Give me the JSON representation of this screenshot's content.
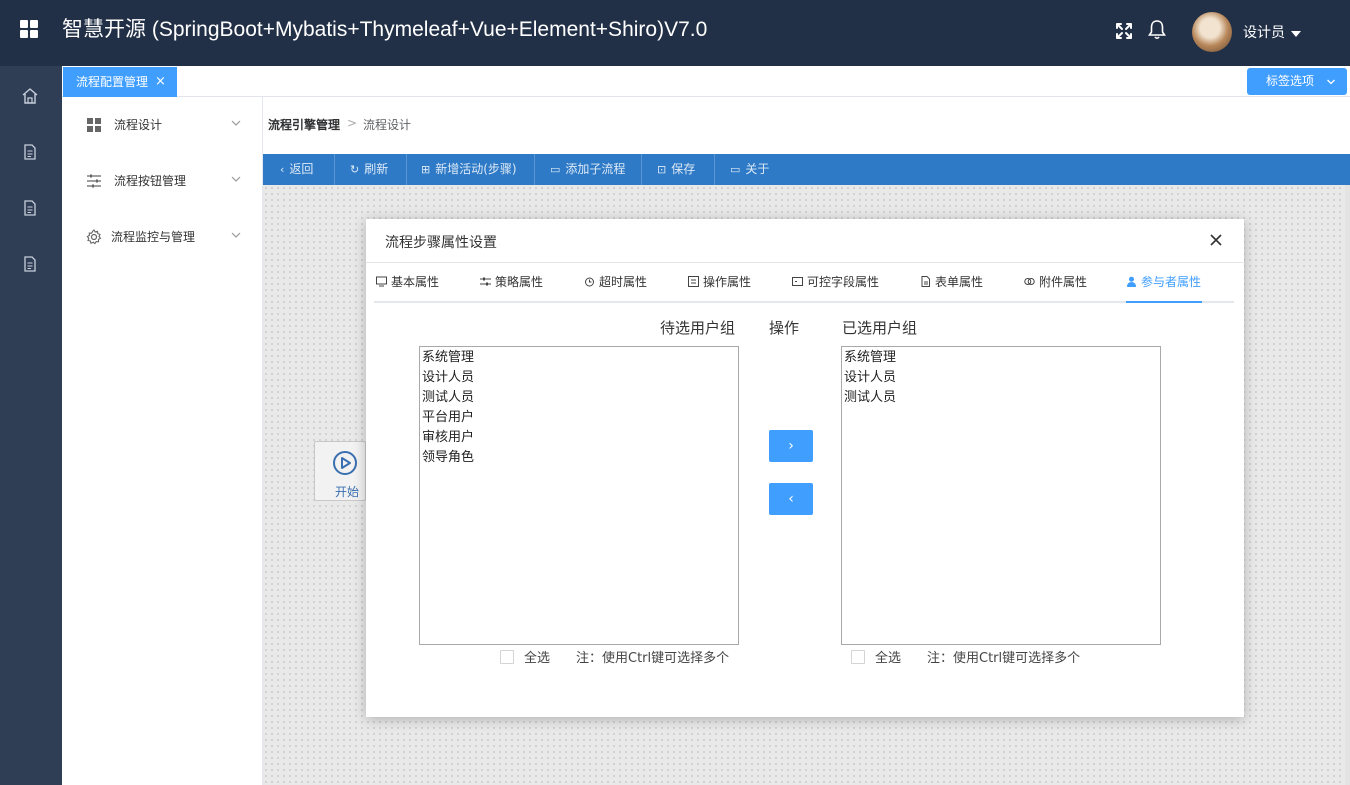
{
  "header": {
    "title": "智慧开源 (SpringBoot+Mybatis+Thymeleaf+Vue+Element+Shiro)V7.0",
    "user_name": "设计员"
  },
  "tabs": {
    "active_label": "流程配置管理",
    "close_glyph": "×",
    "tag_options_label": "标签选项"
  },
  "sidebar": {
    "items": [
      {
        "label": "流程设计",
        "icon": "grid-icon"
      },
      {
        "label": "流程按钮管理",
        "icon": "sliders-icon"
      },
      {
        "label": "流程监控与管理",
        "icon": "gear-icon"
      }
    ]
  },
  "breadcrumb": {
    "root": "流程引擎管理",
    "separator": ">",
    "current": "流程设计"
  },
  "toolbar": {
    "buttons": [
      {
        "label": "返回",
        "icon": "‹"
      },
      {
        "label": "刷新",
        "icon": "↻"
      },
      {
        "label": "新增活动(步骤)",
        "icon": "⊞"
      },
      {
        "label": "添加子流程",
        "icon": "▭"
      },
      {
        "label": "保存",
        "icon": "⊡"
      },
      {
        "label": "关于",
        "icon": "▭"
      }
    ]
  },
  "canvas": {
    "start_node_label": "开始"
  },
  "modal": {
    "title": "流程步骤属性设置",
    "tabs": [
      {
        "label": "基本属性"
      },
      {
        "label": "策略属性"
      },
      {
        "label": "超时属性"
      },
      {
        "label": "操作属性"
      },
      {
        "label": "可控字段属性"
      },
      {
        "label": "表单属性"
      },
      {
        "label": "附件属性"
      },
      {
        "label": "参与者属性",
        "active": true
      }
    ],
    "available_header": "待选用户组",
    "ops_header": "操作",
    "selected_header": "已选用户组",
    "available_groups": [
      "系统管理",
      "设计人员",
      "测试人员",
      "平台用户",
      "审核用户",
      "领导角色"
    ],
    "selected_groups": [
      "系统管理",
      "设计人员",
      "测试人员"
    ],
    "move_right": "›",
    "move_left": "‹",
    "select_all_label": "全选",
    "note": "注：使用Ctrl键可选择多个"
  },
  "colors": {
    "header_bg": "#223047",
    "rail_bg": "#2f3d55",
    "primary": "#409eff",
    "toolbar_bg": "#2f7ac6"
  }
}
